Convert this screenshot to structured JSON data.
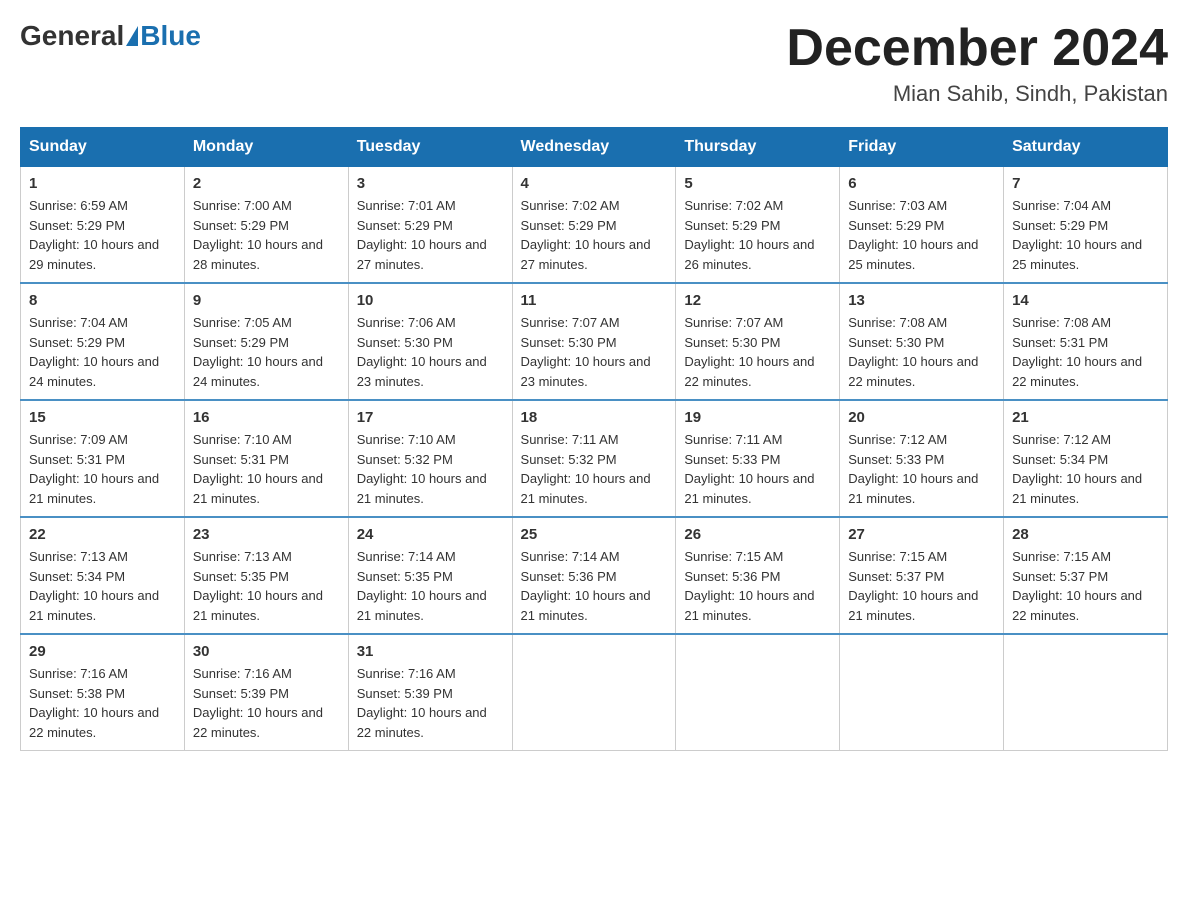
{
  "header": {
    "logo_general": "General",
    "logo_blue": "Blue",
    "month_year": "December 2024",
    "location": "Mian Sahib, Sindh, Pakistan"
  },
  "weekdays": [
    "Sunday",
    "Monday",
    "Tuesday",
    "Wednesday",
    "Thursday",
    "Friday",
    "Saturday"
  ],
  "weeks": [
    [
      {
        "day": "1",
        "sunrise": "6:59 AM",
        "sunset": "5:29 PM",
        "daylight": "10 hours and 29 minutes."
      },
      {
        "day": "2",
        "sunrise": "7:00 AM",
        "sunset": "5:29 PM",
        "daylight": "10 hours and 28 minutes."
      },
      {
        "day": "3",
        "sunrise": "7:01 AM",
        "sunset": "5:29 PM",
        "daylight": "10 hours and 27 minutes."
      },
      {
        "day": "4",
        "sunrise": "7:02 AM",
        "sunset": "5:29 PM",
        "daylight": "10 hours and 27 minutes."
      },
      {
        "day": "5",
        "sunrise": "7:02 AM",
        "sunset": "5:29 PM",
        "daylight": "10 hours and 26 minutes."
      },
      {
        "day": "6",
        "sunrise": "7:03 AM",
        "sunset": "5:29 PM",
        "daylight": "10 hours and 25 minutes."
      },
      {
        "day": "7",
        "sunrise": "7:04 AM",
        "sunset": "5:29 PM",
        "daylight": "10 hours and 25 minutes."
      }
    ],
    [
      {
        "day": "8",
        "sunrise": "7:04 AM",
        "sunset": "5:29 PM",
        "daylight": "10 hours and 24 minutes."
      },
      {
        "day": "9",
        "sunrise": "7:05 AM",
        "sunset": "5:29 PM",
        "daylight": "10 hours and 24 minutes."
      },
      {
        "day": "10",
        "sunrise": "7:06 AM",
        "sunset": "5:30 PM",
        "daylight": "10 hours and 23 minutes."
      },
      {
        "day": "11",
        "sunrise": "7:07 AM",
        "sunset": "5:30 PM",
        "daylight": "10 hours and 23 minutes."
      },
      {
        "day": "12",
        "sunrise": "7:07 AM",
        "sunset": "5:30 PM",
        "daylight": "10 hours and 22 minutes."
      },
      {
        "day": "13",
        "sunrise": "7:08 AM",
        "sunset": "5:30 PM",
        "daylight": "10 hours and 22 minutes."
      },
      {
        "day": "14",
        "sunrise": "7:08 AM",
        "sunset": "5:31 PM",
        "daylight": "10 hours and 22 minutes."
      }
    ],
    [
      {
        "day": "15",
        "sunrise": "7:09 AM",
        "sunset": "5:31 PM",
        "daylight": "10 hours and 21 minutes."
      },
      {
        "day": "16",
        "sunrise": "7:10 AM",
        "sunset": "5:31 PM",
        "daylight": "10 hours and 21 minutes."
      },
      {
        "day": "17",
        "sunrise": "7:10 AM",
        "sunset": "5:32 PM",
        "daylight": "10 hours and 21 minutes."
      },
      {
        "day": "18",
        "sunrise": "7:11 AM",
        "sunset": "5:32 PM",
        "daylight": "10 hours and 21 minutes."
      },
      {
        "day": "19",
        "sunrise": "7:11 AM",
        "sunset": "5:33 PM",
        "daylight": "10 hours and 21 minutes."
      },
      {
        "day": "20",
        "sunrise": "7:12 AM",
        "sunset": "5:33 PM",
        "daylight": "10 hours and 21 minutes."
      },
      {
        "day": "21",
        "sunrise": "7:12 AM",
        "sunset": "5:34 PM",
        "daylight": "10 hours and 21 minutes."
      }
    ],
    [
      {
        "day": "22",
        "sunrise": "7:13 AM",
        "sunset": "5:34 PM",
        "daylight": "10 hours and 21 minutes."
      },
      {
        "day": "23",
        "sunrise": "7:13 AM",
        "sunset": "5:35 PM",
        "daylight": "10 hours and 21 minutes."
      },
      {
        "day": "24",
        "sunrise": "7:14 AM",
        "sunset": "5:35 PM",
        "daylight": "10 hours and 21 minutes."
      },
      {
        "day": "25",
        "sunrise": "7:14 AM",
        "sunset": "5:36 PM",
        "daylight": "10 hours and 21 minutes."
      },
      {
        "day": "26",
        "sunrise": "7:15 AM",
        "sunset": "5:36 PM",
        "daylight": "10 hours and 21 minutes."
      },
      {
        "day": "27",
        "sunrise": "7:15 AM",
        "sunset": "5:37 PM",
        "daylight": "10 hours and 21 minutes."
      },
      {
        "day": "28",
        "sunrise": "7:15 AM",
        "sunset": "5:37 PM",
        "daylight": "10 hours and 22 minutes."
      }
    ],
    [
      {
        "day": "29",
        "sunrise": "7:16 AM",
        "sunset": "5:38 PM",
        "daylight": "10 hours and 22 minutes."
      },
      {
        "day": "30",
        "sunrise": "7:16 AM",
        "sunset": "5:39 PM",
        "daylight": "10 hours and 22 minutes."
      },
      {
        "day": "31",
        "sunrise": "7:16 AM",
        "sunset": "5:39 PM",
        "daylight": "10 hours and 22 minutes."
      },
      null,
      null,
      null,
      null
    ]
  ]
}
